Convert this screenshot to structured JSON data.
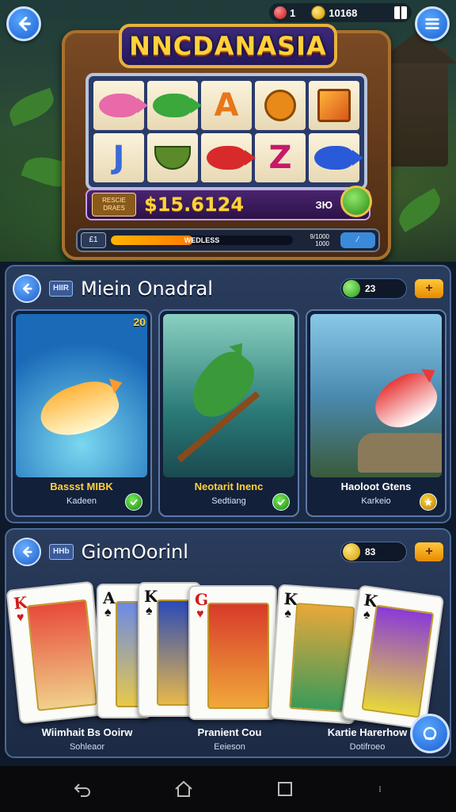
{
  "hud": {
    "gems": "1",
    "coins": "10168"
  },
  "slot": {
    "title": "NNCDANASIA",
    "reel_letters": [
      "A",
      "J",
      "Z"
    ],
    "win_label": "RESCIE DRAES",
    "win_amount": "$15.6124",
    "multiplier": "ЗЮ",
    "level": "£1",
    "xp_text": "WEDLESS",
    "xp_progress": 0.45,
    "xp_sub": "9/1000 1000"
  },
  "section1": {
    "tag": "HIIR",
    "title": "Miein Onadral",
    "pill_value": "23",
    "plus": "+",
    "cards": [
      {
        "name": "Bassst MIBK",
        "sub": "Kadeen",
        "badge": "20"
      },
      {
        "name": "Neotarit Inenc",
        "sub": "Sedtiang",
        "badge": ""
      },
      {
        "name": "Haoloot Gtens",
        "sub": "Karkeio",
        "badge": ""
      }
    ]
  },
  "section2": {
    "tag": "HHb",
    "title": "GiomOorinl",
    "pill_value": "83",
    "plus": "+",
    "playing_cards": [
      {
        "rank": "K",
        "suit": "♥",
        "color": "red"
      },
      {
        "rank": "A",
        "suit": "♠",
        "color": "black"
      },
      {
        "rank": "K",
        "suit": "♠",
        "color": "black"
      },
      {
        "rank": "G",
        "suit": "♥",
        "color": "red"
      },
      {
        "rank": "K",
        "suit": "♠",
        "color": "black"
      },
      {
        "rank": "K",
        "suit": "♠",
        "color": "black"
      }
    ],
    "labels": [
      {
        "name": "Wiimhait Bs Ooirw",
        "sub": "Sohleaor"
      },
      {
        "name": "Pranient Cou",
        "sub": "Eeieson"
      },
      {
        "name": "Kartie Harerhow",
        "sub": "Dotifroeo"
      }
    ]
  },
  "icons": {
    "back": "back-arrow-icon",
    "menu": "hamburger-icon",
    "nav_back": "nav-back-icon",
    "nav_home": "nav-home-icon",
    "nav_recents": "nav-recents-icon"
  }
}
